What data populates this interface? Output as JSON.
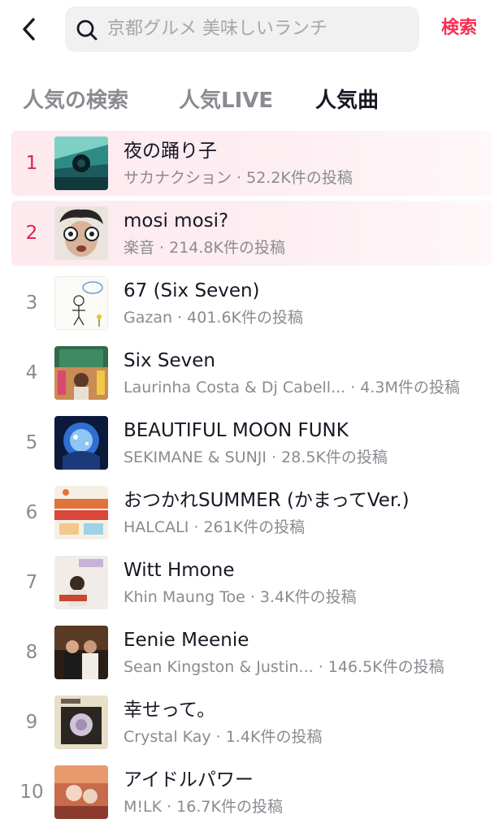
{
  "header": {
    "search_placeholder": "京都グルメ 美味しいランチ",
    "search_action": "検索"
  },
  "tabs": [
    {
      "label": "人気の検索",
      "active": false
    },
    {
      "label": "人気LIVE",
      "active": false
    },
    {
      "label": "人気曲",
      "active": true
    }
  ],
  "songs": [
    {
      "rank": "1",
      "title": "夜の踊り子",
      "meta": "サカナクション · 52.2K件の投稿"
    },
    {
      "rank": "2",
      "title": "mosi mosi?",
      "meta": "楽音 · 214.8K件の投稿"
    },
    {
      "rank": "3",
      "title": "67 (Six Seven)",
      "meta": "Gazan · 401.6K件の投稿"
    },
    {
      "rank": "4",
      "title": "Six Seven",
      "meta": "Laurinha Costa & Dj Cabell... · 4.3M件の投稿"
    },
    {
      "rank": "5",
      "title": "BEAUTIFUL MOON FUNK",
      "meta": "SEKIMANE & SUNJI · 28.5K件の投稿"
    },
    {
      "rank": "6",
      "title": "おつかれSUMMER (かまってVer.)",
      "meta": "HALCALI · 261K件の投稿"
    },
    {
      "rank": "7",
      "title": "Witt Hmone",
      "meta": "Khin Maung Toe · 3.4K件の投稿"
    },
    {
      "rank": "8",
      "title": "Eenie Meenie",
      "meta": "Sean Kingston & Justin...    · 146.5K件の投稿"
    },
    {
      "rank": "9",
      "title": "幸せって。",
      "meta": "Crystal Kay · 1.4K件の投稿"
    },
    {
      "rank": "10",
      "title": "アイドルパワー",
      "meta": "M!LK · 16.7K件の投稿"
    }
  ],
  "colors": {
    "accent": "#fe2c55",
    "rank_hot": "#e0204d",
    "highlight_bg": "#fde9ee",
    "muted": "#8a8b91"
  },
  "icons": {
    "back": "chevron-left-icon",
    "search": "search-icon"
  }
}
